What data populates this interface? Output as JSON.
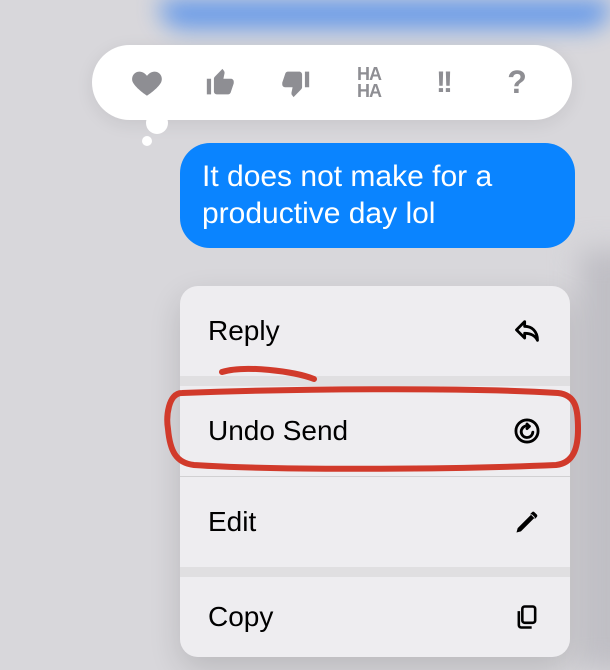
{
  "message": {
    "text": "It does not make for a productive day lol"
  },
  "tapbacks": [
    {
      "name": "heart"
    },
    {
      "name": "thumbs-up"
    },
    {
      "name": "thumbs-down"
    },
    {
      "name": "haha"
    },
    {
      "name": "exclaim"
    },
    {
      "name": "question"
    }
  ],
  "menu": {
    "reply": {
      "label": "Reply"
    },
    "undo_send": {
      "label": "Undo Send",
      "highlighted": true
    },
    "edit": {
      "label": "Edit"
    },
    "copy": {
      "label": "Copy"
    }
  },
  "icons": {
    "reply": "reply-arrow-icon",
    "undo_send": "undo-circle-icon",
    "edit": "pencil-icon",
    "copy": "copy-pages-icon"
  }
}
